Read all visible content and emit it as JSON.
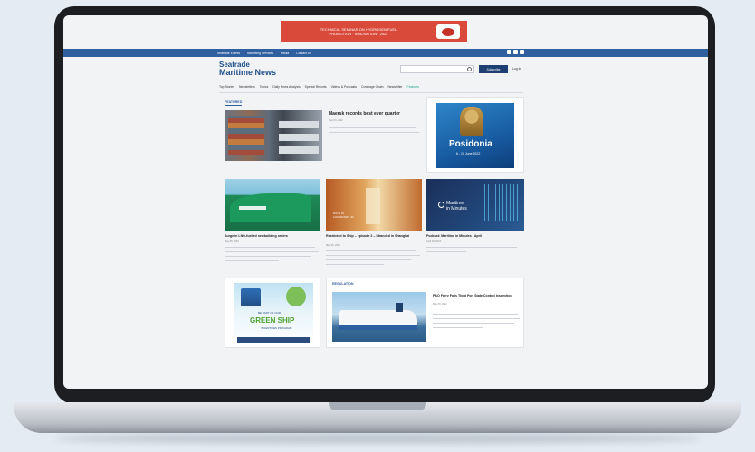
{
  "banner": {
    "text_line1": "TECHNICAL SEMINAR ON HYDROGEN FUEL",
    "text_line2": "PROMOTION · INNOVATION · 2022",
    "colors": {
      "bg": "#d94a3b"
    }
  },
  "topnav": {
    "links": [
      "Seatrade Events",
      "Marketing Services",
      "Media",
      "Contact Us"
    ],
    "colors": {
      "bg": "#2f5f9e"
    }
  },
  "site": {
    "logo_line1": "Seatrade",
    "logo_line2": "Maritime News",
    "subscribe_label": "Subscribe",
    "login_label": "Log in"
  },
  "categories": [
    "Top Stories",
    "Newsletters",
    "Topics",
    "Daily News Analysis",
    "Special Reports",
    "Videos & Podcasts",
    "Coverage Chain",
    "Newsletter",
    "Features"
  ],
  "featured": {
    "section_label": "FEATURED",
    "headline": "Maersk records best ever quarter",
    "date": "May 04, 2022"
  },
  "posidonia": {
    "title": "Posidonia",
    "subtitle": "6 - 10 June 2022"
  },
  "cards": [
    {
      "headline": "Surge in LNG-fuelled newbuilding orders",
      "date": "May 05, 2022"
    },
    {
      "headline": "Restricted to Ship – episode 2 – Stranded in Shanghai",
      "date": "May 05, 2022",
      "overlay": "DAYS IN LOCKDOWN: 42"
    },
    {
      "headline": "Podcast: Maritime in Minutes - April",
      "date": "April 29, 2022"
    }
  ],
  "mim": {
    "line1": "Maritime",
    "line2": "in Minutes"
  },
  "greenship": {
    "top": "BE PART OF OUR",
    "title": "GREEN SHIP",
    "sub": "INCENTIVES PROGRAM"
  },
  "regulation": {
    "section_label": "REGULATION",
    "headline": "P&O Ferry Fails Third Port State Control Inspection",
    "date": "May 06, 2022"
  }
}
